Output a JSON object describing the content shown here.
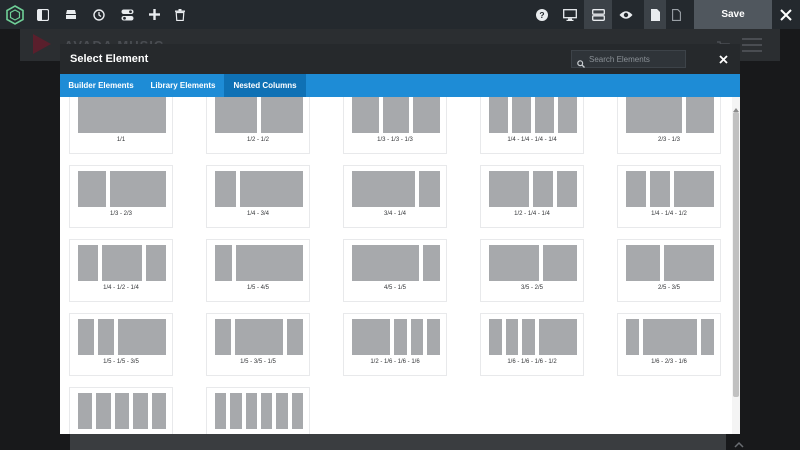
{
  "toolbar": {
    "save_label": "Save",
    "icons": [
      "avada-logo-icon",
      "sidebar-icon",
      "library-icon",
      "history-icon",
      "toggles-icon",
      "plus-icon",
      "trash-icon",
      "help-icon",
      "desktop-icon",
      "layout-icon",
      "eye-icon",
      "page-icon",
      "blank-page-icon",
      "close-icon"
    ]
  },
  "page": {
    "brand": "AVADA MUSIC"
  },
  "modal": {
    "title": "Select Element",
    "search_placeholder": "Search Elements",
    "tabs": [
      {
        "label": "Builder Elements",
        "active": false
      },
      {
        "label": "Library Elements",
        "active": false
      },
      {
        "label": "Nested Columns",
        "active": true
      }
    ],
    "layouts": [
      {
        "label": "1/1",
        "columns": [
          1
        ]
      },
      {
        "label": "1/2 - 1/2",
        "columns": [
          0.5,
          0.5
        ]
      },
      {
        "label": "1/3 - 1/3 - 1/3",
        "columns": [
          0.3333,
          0.3333,
          0.3333
        ]
      },
      {
        "label": "1/4 - 1/4 - 1/4 - 1/4",
        "columns": [
          0.25,
          0.25,
          0.25,
          0.25
        ]
      },
      {
        "label": "2/3 - 1/3",
        "columns": [
          0.6667,
          0.3333
        ]
      },
      {
        "label": "1/3 - 2/3",
        "columns": [
          0.3333,
          0.6667
        ]
      },
      {
        "label": "1/4 - 3/4",
        "columns": [
          0.25,
          0.75
        ]
      },
      {
        "label": "3/4 - 1/4",
        "columns": [
          0.75,
          0.25
        ]
      },
      {
        "label": "1/2 - 1/4 - 1/4",
        "columns": [
          0.5,
          0.25,
          0.25
        ]
      },
      {
        "label": "1/4 - 1/4 - 1/2",
        "columns": [
          0.25,
          0.25,
          0.5
        ]
      },
      {
        "label": "1/4 - 1/2 - 1/4",
        "columns": [
          0.25,
          0.5,
          0.25
        ]
      },
      {
        "label": "1/5 - 4/5",
        "columns": [
          0.2,
          0.8
        ]
      },
      {
        "label": "4/5 - 1/5",
        "columns": [
          0.8,
          0.2
        ]
      },
      {
        "label": "3/5 - 2/5",
        "columns": [
          0.6,
          0.4
        ]
      },
      {
        "label": "2/5 - 3/5",
        "columns": [
          0.4,
          0.6
        ]
      },
      {
        "label": "1/5 - 1/5 - 3/5",
        "columns": [
          0.2,
          0.2,
          0.6
        ]
      },
      {
        "label": "1/5 - 3/5 - 1/5",
        "columns": [
          0.2,
          0.6,
          0.2
        ]
      },
      {
        "label": "1/2 - 1/6 - 1/6 - 1/6",
        "columns": [
          0.5,
          0.1667,
          0.1667,
          0.1667
        ]
      },
      {
        "label": "1/6 - 1/6 - 1/6 - 1/2",
        "columns": [
          0.1667,
          0.1667,
          0.1667,
          0.5
        ]
      },
      {
        "label": "1/6 - 2/3 - 1/6",
        "columns": [
          0.1667,
          0.6667,
          0.1667
        ]
      },
      {
        "label": "",
        "columns": [
          0.2,
          0.2,
          0.2,
          0.2,
          0.2
        ]
      },
      {
        "label": "",
        "columns": [
          0.1667,
          0.1667,
          0.1667,
          0.1667,
          0.1667,
          0.1667
        ]
      }
    ]
  },
  "colors": {
    "toolbar": "#24292e",
    "modal_header": "#26292c",
    "tabs": "#1e8cd6",
    "tab_active": "#0f71b5",
    "column_bar": "#a7a9ac"
  }
}
